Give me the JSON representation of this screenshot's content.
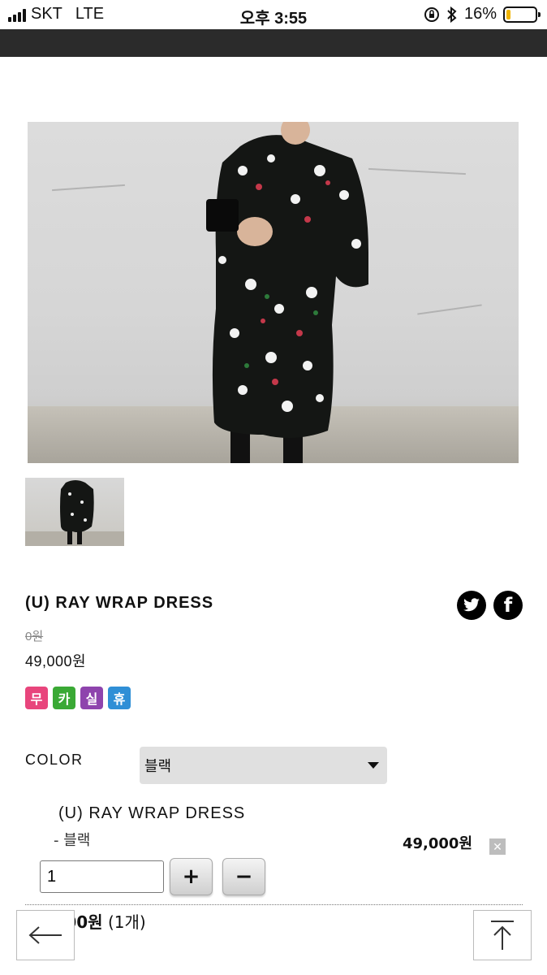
{
  "status_bar": {
    "carrier": "SKT",
    "network": "LTE",
    "time": "오후 3:55",
    "battery": "16%",
    "battery_level": 0.16
  },
  "product": {
    "title": "(U) RAY WRAP DRESS",
    "original_price": "0원",
    "sale_price": "49,000원",
    "badges": [
      {
        "label": "무",
        "color": "#e8457c"
      },
      {
        "label": "카",
        "color": "#3aa935"
      },
      {
        "label": "실",
        "color": "#8e44ad"
      },
      {
        "label": "휴",
        "color": "#2f8fd6"
      }
    ]
  },
  "share": {
    "twitter_icon": "twitter-icon",
    "facebook_icon": "facebook-icon",
    "facebook_glyph": "f"
  },
  "options": {
    "color_label": "COLOR",
    "color_selected": "블랙"
  },
  "selected_item": {
    "name": "(U) RAY WRAP DRESS",
    "variant": "- 블랙",
    "price": "49,000원",
    "remove_glyph": "✕",
    "quantity": "1",
    "plus_label": "+",
    "minus_label": "−"
  },
  "total": {
    "amount": "49,000원",
    "count": "(1개)"
  },
  "nav": {
    "back_icon": "arrow-left-icon",
    "top_icon": "arrow-up-to-top-icon"
  }
}
